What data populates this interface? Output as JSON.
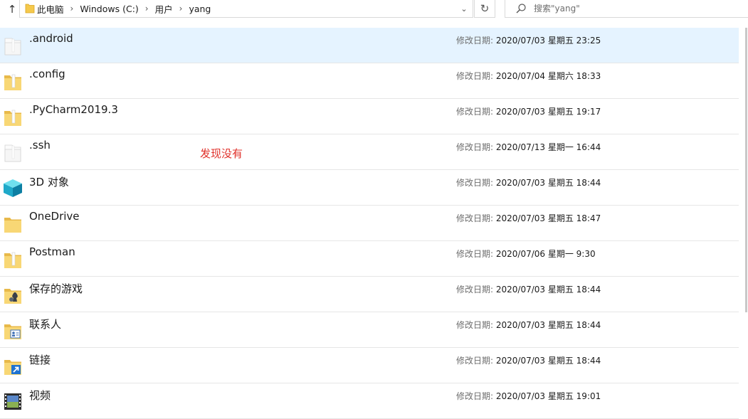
{
  "address_bar": {
    "crumbs": [
      "此电脑",
      "Windows (C:)",
      "用户",
      "yang"
    ],
    "separator": "›",
    "dropdown_glyph": "⌄"
  },
  "search": {
    "placeholder": "搜索\"yang\""
  },
  "date_label": "修改日期:",
  "annotation": "发现没有",
  "items": [
    {
      "name": ".android",
      "date": "2020/07/03 星期五 23:25",
      "icon": "folder-plain-icon",
      "selected": true
    },
    {
      "name": ".config",
      "date": "2020/07/04 星期六 18:33",
      "icon": "folder-icon"
    },
    {
      "name": ".PyCharm2019.3",
      "date": "2020/07/03 星期五 19:17",
      "icon": "folder-icon"
    },
    {
      "name": ".ssh",
      "date": "2020/07/13 星期一 16:44",
      "icon": "folder-plain-icon"
    },
    {
      "name": "3D 对象",
      "date": "2020/07/03 星期五 18:44",
      "icon": "3d-objects-icon"
    },
    {
      "name": "OneDrive",
      "date": "2020/07/03 星期五 18:47",
      "icon": "onedrive-folder-icon"
    },
    {
      "name": "Postman",
      "date": "2020/07/06 星期一 9:30",
      "icon": "folder-icon"
    },
    {
      "name": "保存的游戏",
      "date": "2020/07/03 星期五 18:44",
      "icon": "saved-games-icon"
    },
    {
      "name": "联系人",
      "date": "2020/07/03 星期五 18:44",
      "icon": "contacts-icon"
    },
    {
      "name": "链接",
      "date": "2020/07/03 星期五 18:44",
      "icon": "links-icon"
    },
    {
      "name": "视频",
      "date": "2020/07/03 星期五 19:01",
      "icon": "videos-icon"
    }
  ],
  "colors": {
    "selected_row": "#e5f3ff",
    "folder": "#f8d775",
    "annotation": "#e0302a"
  }
}
